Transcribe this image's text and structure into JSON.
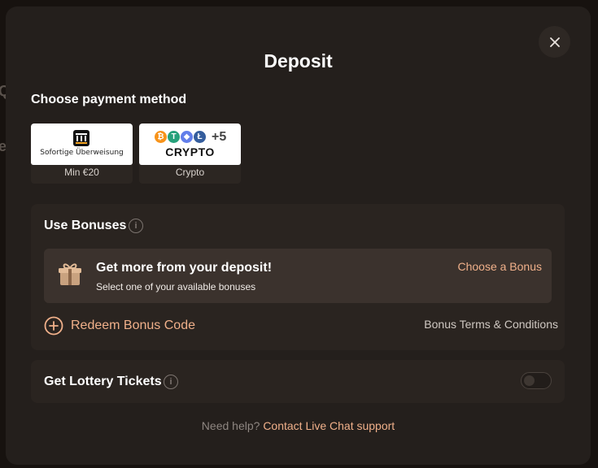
{
  "modal": {
    "title": "Deposit",
    "close_icon": "close-icon"
  },
  "payment": {
    "section_label": "Choose payment method",
    "methods": [
      {
        "logo_text": "Sofortige Überweisung",
        "caption": "Min €20",
        "icon": "bank-icon"
      },
      {
        "logo_text": "CRYPTO",
        "extra": "+5",
        "caption": "Crypto",
        "icons": [
          "bitcoin-icon",
          "tether-icon",
          "ethereum-icon",
          "litecoin-icon"
        ]
      }
    ]
  },
  "bonuses": {
    "title": "Use Bonuses",
    "box_heading": "Get more from your deposit!",
    "box_sub": "Select one of your available bonuses",
    "choose_label": "Choose a Bonus",
    "redeem_label": "Redeem Bonus Code",
    "terms_label": "Bonus Terms & Conditions"
  },
  "lottery": {
    "title": "Get Lottery Tickets",
    "toggle_on": false
  },
  "help": {
    "question": "Need help?",
    "link": "Contact Live Chat support"
  },
  "colors": {
    "accent": "#f0b08a",
    "modal_bg": "#241f1c",
    "card_bg": "#2a2420",
    "bonus_box_bg": "#3b322d"
  }
}
